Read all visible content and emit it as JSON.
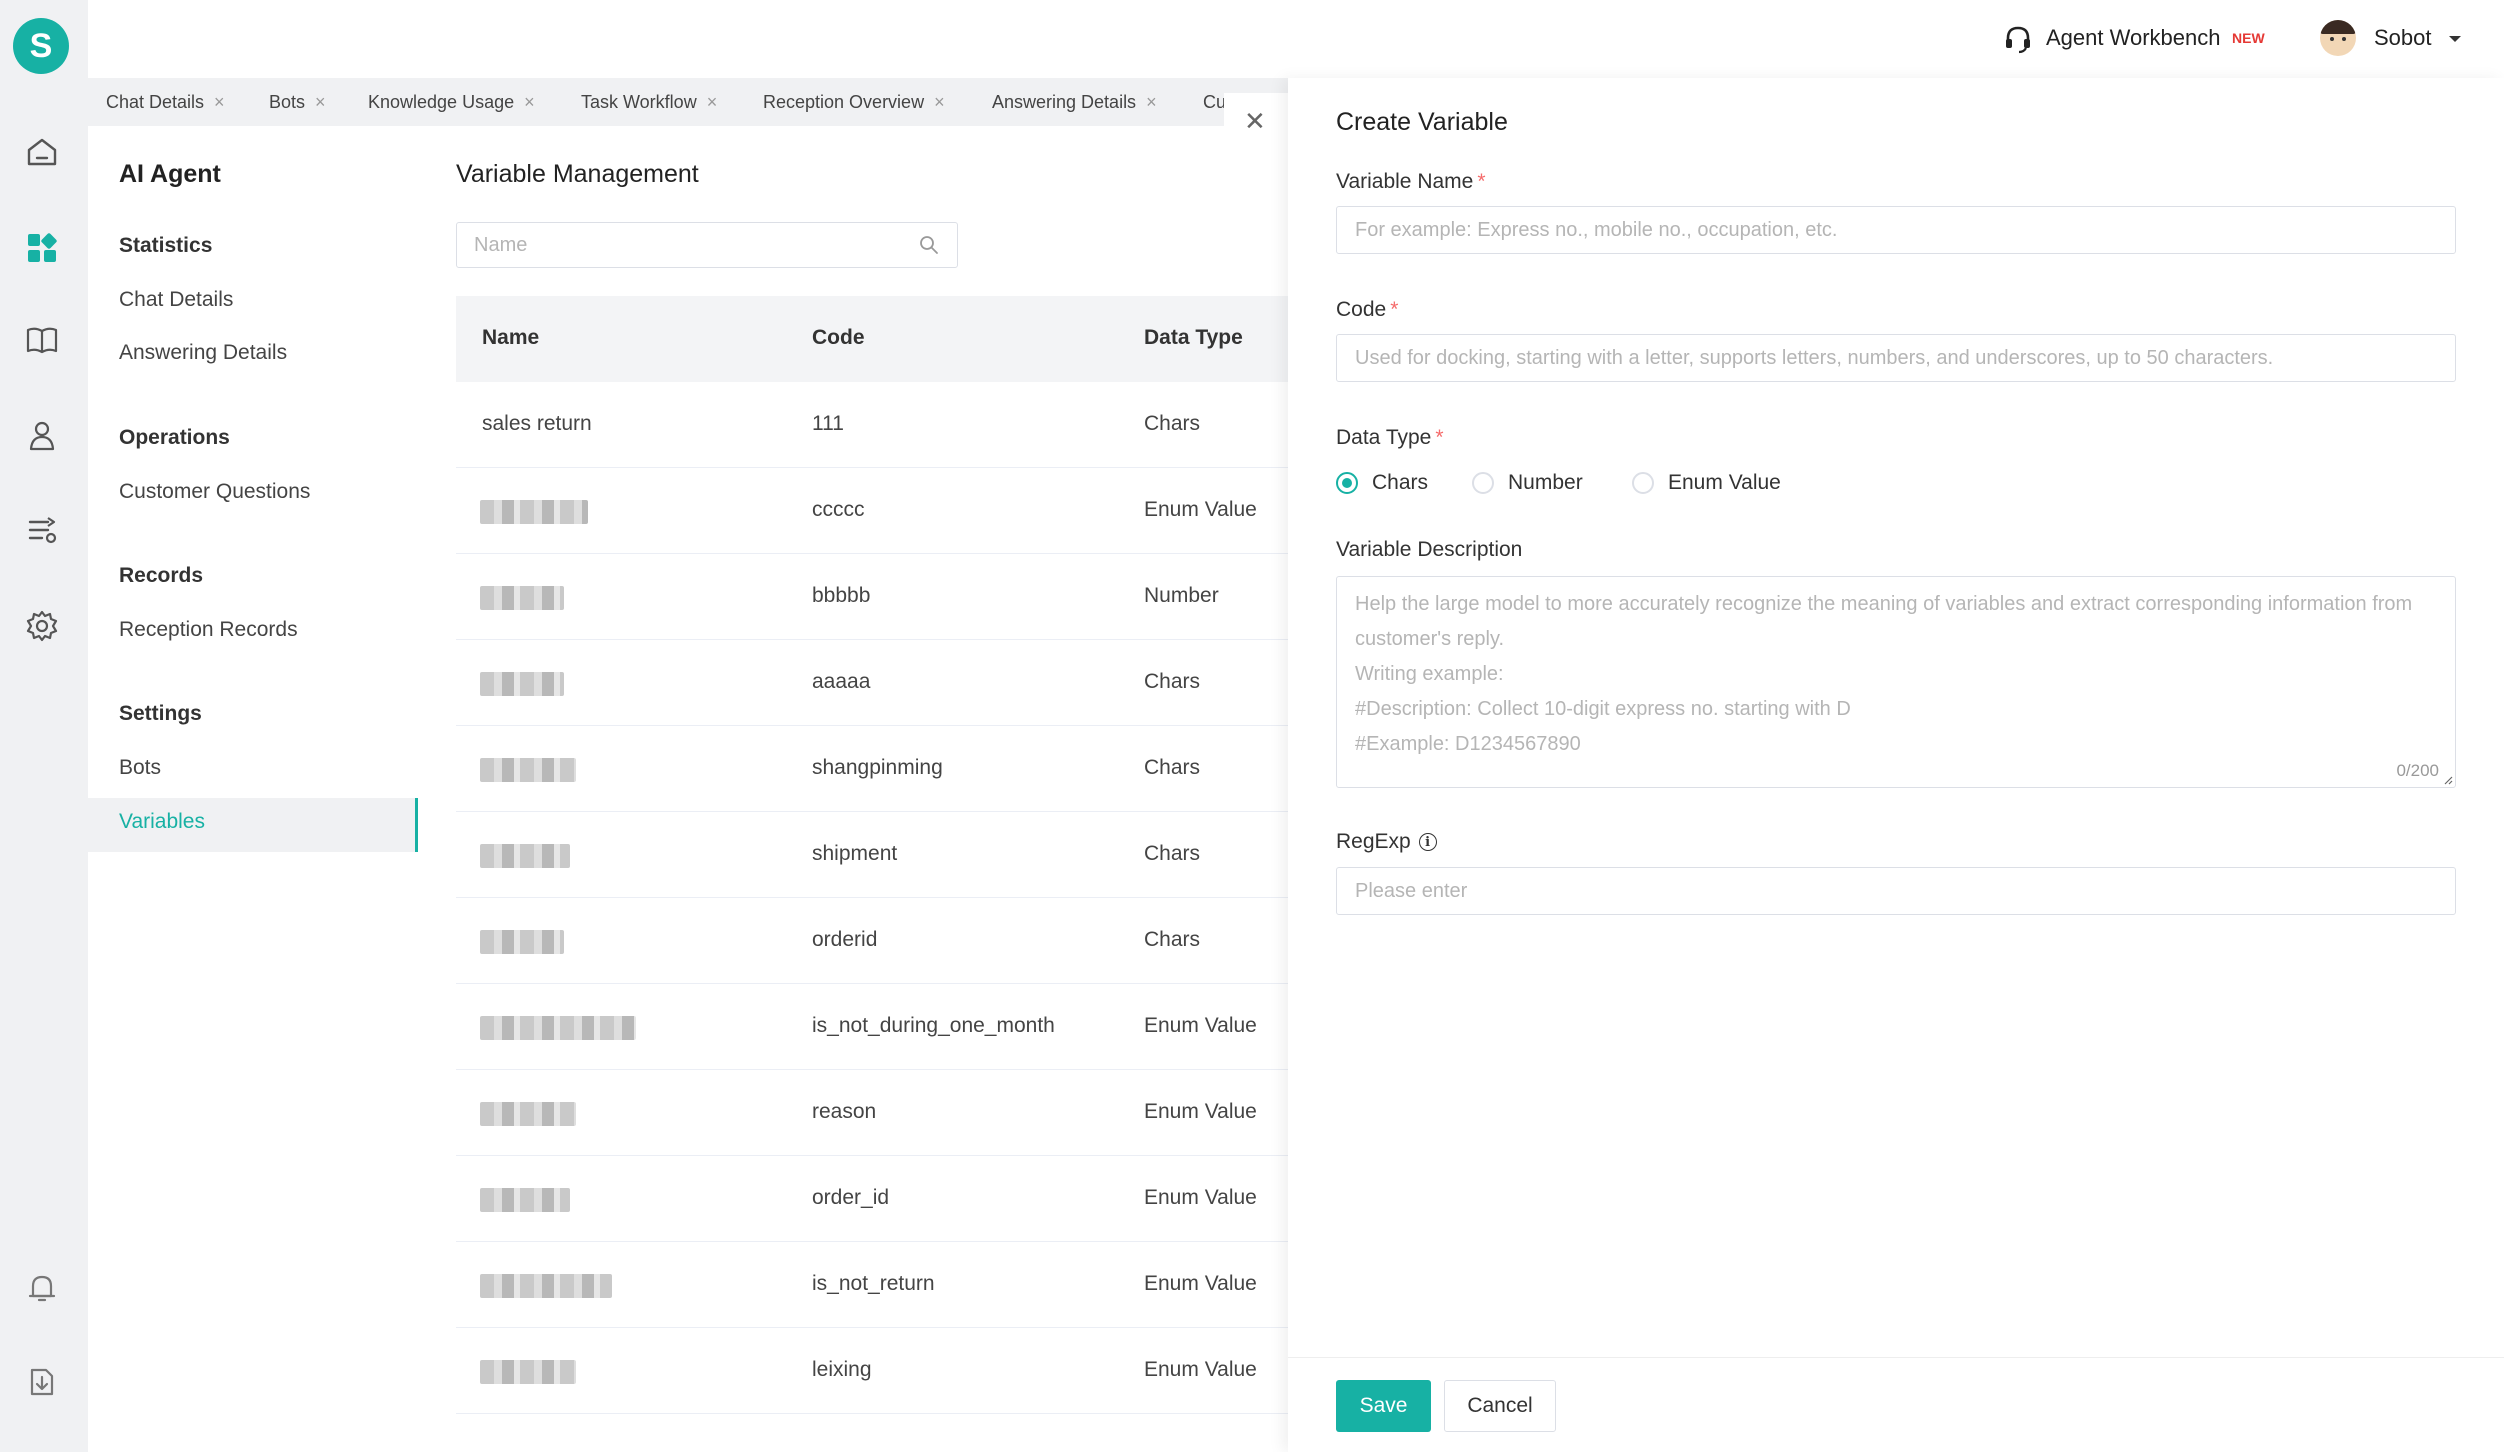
{
  "header": {
    "workbench_label": "Agent Workbench",
    "new_badge": "NEW",
    "user_name": "Sobot"
  },
  "rail": {
    "logo_letter": "S",
    "icons": [
      "home-icon",
      "dashboard-icon",
      "book-icon",
      "user-icon",
      "workflow-icon",
      "settings-icon",
      "bell-icon",
      "download-icon"
    ]
  },
  "tabs": [
    {
      "label": "Chat Details",
      "close": "×"
    },
    {
      "label": "Bots",
      "close": "×"
    },
    {
      "label": "Knowledge Usage",
      "close": "×"
    },
    {
      "label": "Task Workflow",
      "close": "×"
    },
    {
      "label": "Reception Overview",
      "close": "×"
    },
    {
      "label": "Answering Details",
      "close": "×"
    },
    {
      "label": "Cu",
      "close": ""
    }
  ],
  "sidebar": {
    "title": "AI Agent",
    "groups": [
      {
        "title": "Statistics",
        "items": [
          "Chat Details",
          "Answering Details"
        ]
      },
      {
        "title": "Operations",
        "items": [
          "Customer Questions"
        ]
      },
      {
        "title": "Records",
        "items": [
          "Reception Records"
        ]
      },
      {
        "title": "Settings",
        "items": [
          "Bots",
          "Variables"
        ]
      }
    ],
    "active_item": "Variables"
  },
  "main": {
    "title": "Variable Management",
    "search_placeholder": "Name",
    "columns": [
      "Name",
      "Code",
      "Data Type"
    ],
    "rows": [
      {
        "name": "sales return",
        "code": "111",
        "type": "Chars"
      },
      {
        "name": "",
        "code": "ccccc",
        "type": "Enum Value"
      },
      {
        "name": "",
        "code": "bbbbb",
        "type": "Number"
      },
      {
        "name": "",
        "code": "aaaaa",
        "type": "Chars"
      },
      {
        "name": "",
        "code": "shangpinming",
        "type": "Chars"
      },
      {
        "name": "",
        "code": "shipment",
        "type": "Chars"
      },
      {
        "name": "",
        "code": "orderid",
        "type": "Chars"
      },
      {
        "name": "",
        "code": "is_not_during_one_month",
        "type": "Enum Value"
      },
      {
        "name": "",
        "code": "reason",
        "type": "Enum Value"
      },
      {
        "name": "",
        "code": "order_id",
        "type": "Enum Value"
      },
      {
        "name": "",
        "code": "is_not_return",
        "type": "Enum Value"
      },
      {
        "name": "",
        "code": "leixing",
        "type": "Enum Value"
      }
    ]
  },
  "drawer": {
    "title": "Create Variable",
    "close_glyph": "✕",
    "variable_name": {
      "label": "Variable Name",
      "required": "*",
      "placeholder": "For example: Express no., mobile no., occupation, etc.",
      "value": ""
    },
    "code": {
      "label": "Code",
      "required": "*",
      "placeholder": "Used for docking, starting with a letter, supports letters, numbers, and underscores, up to 50 characters.",
      "value": ""
    },
    "data_type": {
      "label": "Data Type",
      "required": "*",
      "options": [
        "Chars",
        "Number",
        "Enum Value"
      ],
      "selected": "Chars"
    },
    "description": {
      "label": "Variable Description",
      "placeholder": "Help the large model to more accurately recognize the meaning of variables and extract corresponding information from customer's reply.\nWriting example:\n#Description: Collect 10-digit express no. starting with D\n#Example: D1234567890",
      "counter": "0/200"
    },
    "regexp": {
      "label": "RegExp",
      "info_glyph": "i",
      "placeholder": "Please enter",
      "value": ""
    },
    "save_label": "Save",
    "cancel_label": "Cancel"
  },
  "colors": {
    "accent": "#17b1a4",
    "required": "#f56c6c",
    "new_badge": "#e53935"
  }
}
